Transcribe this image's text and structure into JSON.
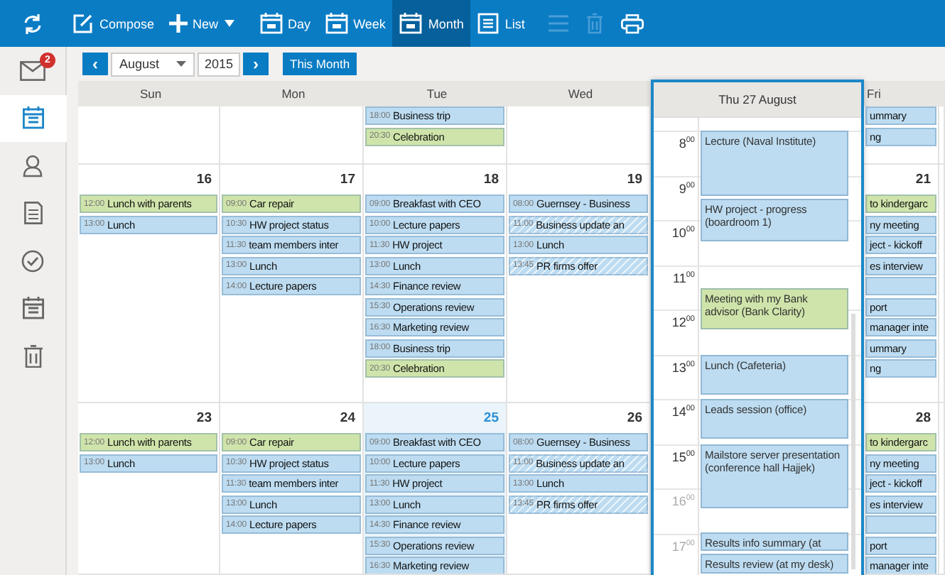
{
  "toolbar": {
    "buttons": [
      {
        "label": "Compose",
        "selected": false,
        "caret": false
      },
      {
        "label": "New",
        "selected": false,
        "caret": true
      },
      {
        "label": "Day",
        "selected": false,
        "caret": false
      },
      {
        "label": "Week",
        "selected": false,
        "caret": false
      },
      {
        "label": "Month",
        "selected": true,
        "caret": false
      },
      {
        "label": "List",
        "selected": false,
        "caret": false
      }
    ],
    "tools": [
      {
        "disabled": true
      },
      {
        "disabled": true
      },
      {
        "disabled": false
      }
    ]
  },
  "sidebar": {
    "items": [
      {
        "selected": false,
        "badge": "2"
      },
      {
        "selected": true
      },
      {
        "selected": false
      },
      {
        "selected": false
      },
      {
        "selected": false
      },
      {
        "selected": false
      },
      {
        "selected": false
      }
    ]
  },
  "nav": {
    "prev": "‹",
    "month": "August",
    "year": "2015",
    "next": "›",
    "this_month": "This Month"
  },
  "weekdays": [
    "Sun",
    "Mon",
    "Tue",
    "Wed",
    "Fri"
  ],
  "weeks": [
    {
      "days": [
        {
          "today": false
        },
        {
          "today": false
        },
        {
          "today": false,
          "events": [
            {
              "time": "18:00",
              "title": "Business trip",
              "color": "#bddcf1",
              "hatched": false
            },
            {
              "time": "20:30",
              "title": "Celebration",
              "color": "#cfe4aa",
              "hatched": false
            }
          ]
        },
        {
          "today": false
        },
        {
          "today": false,
          "events": [
            {
              "title": "ummary",
              "color": "#bddcf1",
              "hatched": false
            },
            {
              "title": "ng",
              "color": "#bddcf1",
              "hatched": false
            }
          ]
        }
      ]
    },
    {
      "days": [
        {
          "date": "16",
          "today": false,
          "events": [
            {
              "time": "12:00",
              "title": "Lunch with parents",
              "color": "#cfe4aa",
              "hatched": false
            },
            {
              "time": "13:00",
              "title": "Lunch",
              "color": "#bddcf1",
              "hatched": false
            }
          ]
        },
        {
          "date": "17",
          "today": false,
          "events": [
            {
              "time": "09:00",
              "title": "Car repair",
              "color": "#cfe4aa",
              "hatched": false
            },
            {
              "time": "10:30",
              "title": "HW project status",
              "color": "#bddcf1",
              "hatched": false
            },
            {
              "time": "11:30",
              "title": "team members inter",
              "color": "#bddcf1",
              "hatched": false
            },
            {
              "time": "13:00",
              "title": "Lunch",
              "color": "#bddcf1",
              "hatched": false
            },
            {
              "time": "14:00",
              "title": "Lecture papers",
              "color": "#bddcf1",
              "hatched": false
            }
          ]
        },
        {
          "date": "18",
          "today": false,
          "events": [
            {
              "time": "09:00",
              "title": "Breakfast with CEO",
              "color": "#bddcf1",
              "hatched": false
            },
            {
              "time": "10:00",
              "title": "Lecture papers",
              "color": "#bddcf1",
              "hatched": false
            },
            {
              "time": "11:30",
              "title": "HW project",
              "color": "#bddcf1",
              "hatched": false
            },
            {
              "time": "13:00",
              "title": "Lunch",
              "color": "#bddcf1",
              "hatched": false
            },
            {
              "time": "14:30",
              "title": "Finance review",
              "color": "#bddcf1",
              "hatched": false
            },
            {
              "time": "15:30",
              "title": "Operations review",
              "color": "#bddcf1",
              "hatched": false
            },
            {
              "time": "16:30",
              "title": "Marketing review",
              "color": "#bddcf1",
              "hatched": false
            },
            {
              "time": "18:00",
              "title": "Business trip",
              "color": "#bddcf1",
              "hatched": false
            },
            {
              "time": "20:30",
              "title": "Celebration",
              "color": "#cfe4aa",
              "hatched": false
            }
          ]
        },
        {
          "date": "19",
          "today": false,
          "events": [
            {
              "time": "08:00",
              "title": "Guernsey - Business",
              "color": "#bddcf1",
              "hatched": false
            },
            {
              "time": "11:00",
              "title": "Business update an",
              "color": "#bddcf1",
              "hatched": true
            },
            {
              "time": "13:00",
              "title": "Lunch",
              "color": "#bddcf1",
              "hatched": false
            },
            {
              "time": "13:45",
              "title": "PR firms offer",
              "color": "#bddcf1",
              "hatched": true
            }
          ]
        },
        {
          "date": "21",
          "today": false,
          "events": [
            {
              "title": "to kindergarc",
              "color": "#cfe4aa",
              "hatched": false
            },
            {
              "title": "ny meeting",
              "color": "#bddcf1",
              "hatched": false
            },
            {
              "title": "ject - kickoff",
              "color": "#bddcf1",
              "hatched": false
            },
            {
              "title": "es interview",
              "color": "#bddcf1",
              "hatched": false
            },
            {
              "color": "#bddcf1",
              "hatched": false
            },
            {
              "title": "port",
              "color": "#bddcf1",
              "hatched": false
            },
            {
              "title": "manager inte",
              "color": "#bddcf1",
              "hatched": false
            },
            {
              "title": "ummary",
              "color": "#bddcf1",
              "hatched": false
            },
            {
              "title": "ng",
              "color": "#bddcf1",
              "hatched": false
            }
          ]
        }
      ]
    },
    {
      "days": [
        {
          "date": "23",
          "today": false,
          "events": [
            {
              "time": "12:00",
              "title": "Lunch with parents",
              "color": "#cfe4aa",
              "hatched": false
            },
            {
              "time": "13:00",
              "title": "Lunch",
              "color": "#bddcf1",
              "hatched": false
            }
          ]
        },
        {
          "date": "24",
          "today": false,
          "events": [
            {
              "time": "09:00",
              "title": "Car repair",
              "color": "#cfe4aa",
              "hatched": false
            },
            {
              "time": "10:30",
              "title": "HW project status",
              "color": "#bddcf1",
              "hatched": false
            },
            {
              "time": "11:30",
              "title": "team members inter",
              "color": "#bddcf1",
              "hatched": false
            },
            {
              "time": "13:00",
              "title": "Lunch",
              "color": "#bddcf1",
              "hatched": false
            },
            {
              "time": "14:00",
              "title": "Lecture papers",
              "color": "#bddcf1",
              "hatched": false
            }
          ]
        },
        {
          "date": "25",
          "today": true,
          "events": [
            {
              "time": "09:00",
              "title": "Breakfast with CEO",
              "color": "#bddcf1",
              "hatched": false
            },
            {
              "time": "10:00",
              "title": "Lecture papers",
              "color": "#bddcf1",
              "hatched": false
            },
            {
              "time": "11:30",
              "title": "HW project",
              "color": "#bddcf1",
              "hatched": false
            },
            {
              "time": "13:00",
              "title": "Lunch",
              "color": "#bddcf1",
              "hatched": false
            },
            {
              "time": "14:30",
              "title": "Finance review",
              "color": "#bddcf1",
              "hatched": false
            },
            {
              "time": "15:30",
              "title": "Operations review",
              "color": "#bddcf1",
              "hatched": false
            },
            {
              "time": "16:30",
              "title": "Marketing review",
              "color": "#bddcf1",
              "hatched": false
            }
          ]
        },
        {
          "date": "26",
          "today": false,
          "events": [
            {
              "time": "08:00",
              "title": "Guernsey - Business",
              "color": "#bddcf1",
              "hatched": false
            },
            {
              "time": "11:00",
              "title": "Business update an",
              "color": "#bddcf1",
              "hatched": true
            },
            {
              "time": "13:00",
              "title": "Lunch",
              "color": "#bddcf1",
              "hatched": false
            },
            {
              "time": "13:45",
              "title": "PR firms offer",
              "color": "#bddcf1",
              "hatched": true
            }
          ]
        },
        {
          "date": "28",
          "today": false,
          "events": [
            {
              "title": "to kindergarc",
              "color": "#cfe4aa",
              "hatched": false
            },
            {
              "title": "ny meeting",
              "color": "#bddcf1",
              "hatched": false
            },
            {
              "title": "ject - kickoff",
              "color": "#bddcf1",
              "hatched": false
            },
            {
              "title": "es interview",
              "color": "#bddcf1",
              "hatched": false
            },
            {
              "color": "#bddcf1",
              "hatched": false
            },
            {
              "title": "port",
              "color": "#bddcf1",
              "hatched": false
            },
            {
              "title": "manager inte",
              "color": "#bddcf1",
              "hatched": false
            }
          ]
        }
      ]
    }
  ],
  "day_popup": {
    "title": "Thu 27 August",
    "hours": [
      {
        "label": "8$^{00}$",
        "dimmed": false
      },
      {
        "label": "9$^{00}$",
        "dimmed": false
      },
      {
        "label": "10$^{00}$",
        "dimmed": false
      },
      {
        "label": "11$^{00}$",
        "dimmed": false
      },
      {
        "label": "12$^{00}$",
        "dimmed": false
      },
      {
        "label": "13$^{00}$",
        "dimmed": false
      },
      {
        "label": "14$^{00}$",
        "dimmed": false
      },
      {
        "label": "15$^{00}$",
        "dimmed": false
      },
      {
        "label": "16$^{00}$",
        "dimmed": true
      },
      {
        "label": "17$^{00}$",
        "dimmed": true
      }
    ],
    "events": [
      {
        "title": "Lecture (Naval Institute)",
        "color": "#bddcf1"
      },
      {
        "title": "HW project - progress (boardroom 1)",
        "color": "#bddcf1"
      },
      {
        "title": "Meeting with my Bank advisor (Bank Clarity)",
        "color": "#cfe4aa"
      },
      {
        "title": "Lunch (Cafeteria)",
        "color": "#bddcf1"
      },
      {
        "title": "Leads session (office)",
        "color": "#bddcf1"
      },
      {
        "title": "Mailstore server presentation (conference hall Hajjek)",
        "color": "#bddcf1"
      },
      {
        "title": "Results info summary (at",
        "color": "#bddcf1"
      },
      {
        "title": "Results review (at my desk)",
        "color": "#bddcf1"
      }
    ]
  }
}
